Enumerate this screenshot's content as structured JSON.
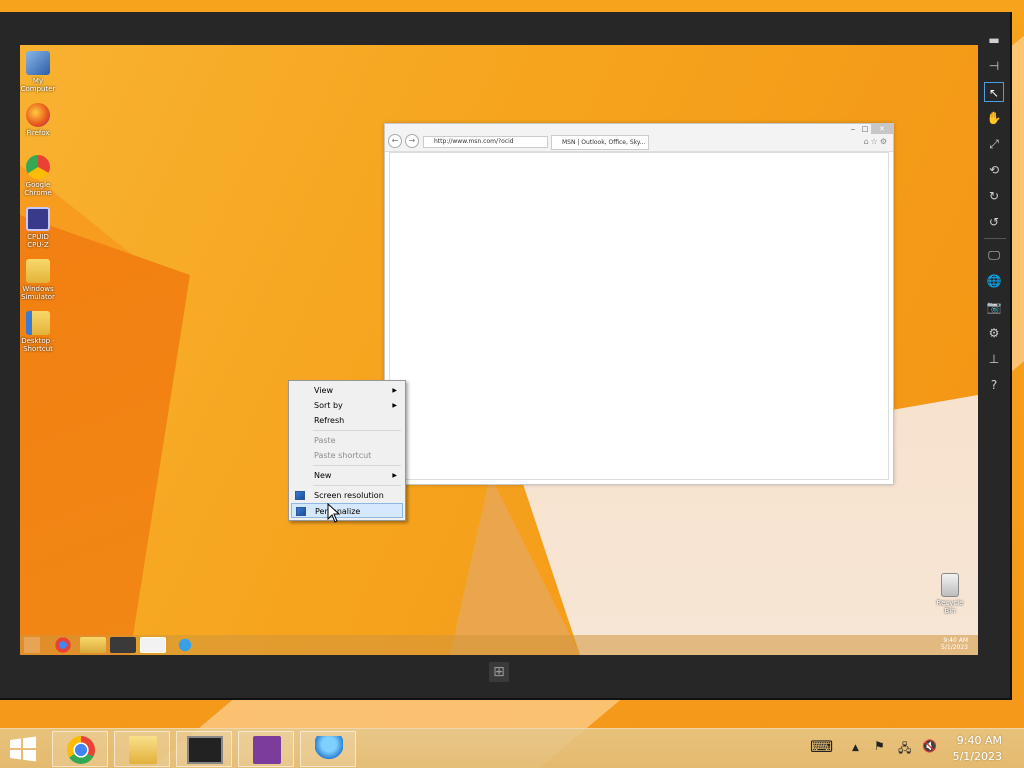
{
  "desktop_icons": [
    {
      "label": "My Computer",
      "icon": "computer-icon"
    },
    {
      "label": "Firefox",
      "icon": "firefox-icon"
    },
    {
      "label": "Google Chrome",
      "icon": "chrome-icon"
    },
    {
      "label": "CPUID CPU-Z",
      "icon": "cpuz-icon"
    },
    {
      "label": "Windows Simulator",
      "icon": "folder-icon"
    },
    {
      "label": "Desktop - Shortcut",
      "icon": "folder-shortcut-icon"
    }
  ],
  "recycle_bin": {
    "label": "Recycle Bin"
  },
  "browser": {
    "address": "http://www.msn.com/?ocid",
    "tab_title": "MSN | Outlook, Office, Sky...",
    "back_glyph": "←",
    "fwd_glyph": "→",
    "caption_min": "‒",
    "caption_max": "□",
    "caption_close": "✕",
    "tools": "⌂☆⚙"
  },
  "context_menu": {
    "items": [
      {
        "label": "View",
        "submenu": true,
        "disabled": false
      },
      {
        "label": "Sort by",
        "submenu": true,
        "disabled": false
      },
      {
        "label": "Refresh",
        "submenu": false,
        "disabled": false
      },
      {
        "label": "Paste",
        "submenu": false,
        "disabled": true
      },
      {
        "label": "Paste shortcut",
        "submenu": false,
        "disabled": true
      },
      {
        "label": "New",
        "submenu": true,
        "disabled": false
      },
      {
        "label": "Screen resolution",
        "submenu": false,
        "disabled": false
      },
      {
        "label": "Personalize",
        "submenu": false,
        "disabled": false,
        "highlighted": true
      }
    ],
    "arrow": "▶"
  },
  "inner_clock": {
    "time": "9:40 AM",
    "date": "5/1/2023"
  },
  "sim_toolbar": {
    "buttons": [
      "▬",
      "⊣",
      "↖",
      "✋",
      "⤢",
      "⟲",
      "↻",
      "↺",
      "🖵",
      "🌐",
      "📷",
      "⚙",
      "⊥",
      "?"
    ]
  },
  "sim_windows_glyph": "⊞",
  "host_taskbar": {
    "start_glyph": "⊞",
    "tray": {
      "keyboard": "⌨",
      "chevron": "▲",
      "flag": "⚑",
      "network": "🖧",
      "volume": "🔇"
    },
    "clock": {
      "time": "9:40 AM",
      "date": "5/1/2023"
    }
  },
  "colors": {
    "accent": "#f6a51f",
    "selection": "#d6e8fb"
  }
}
